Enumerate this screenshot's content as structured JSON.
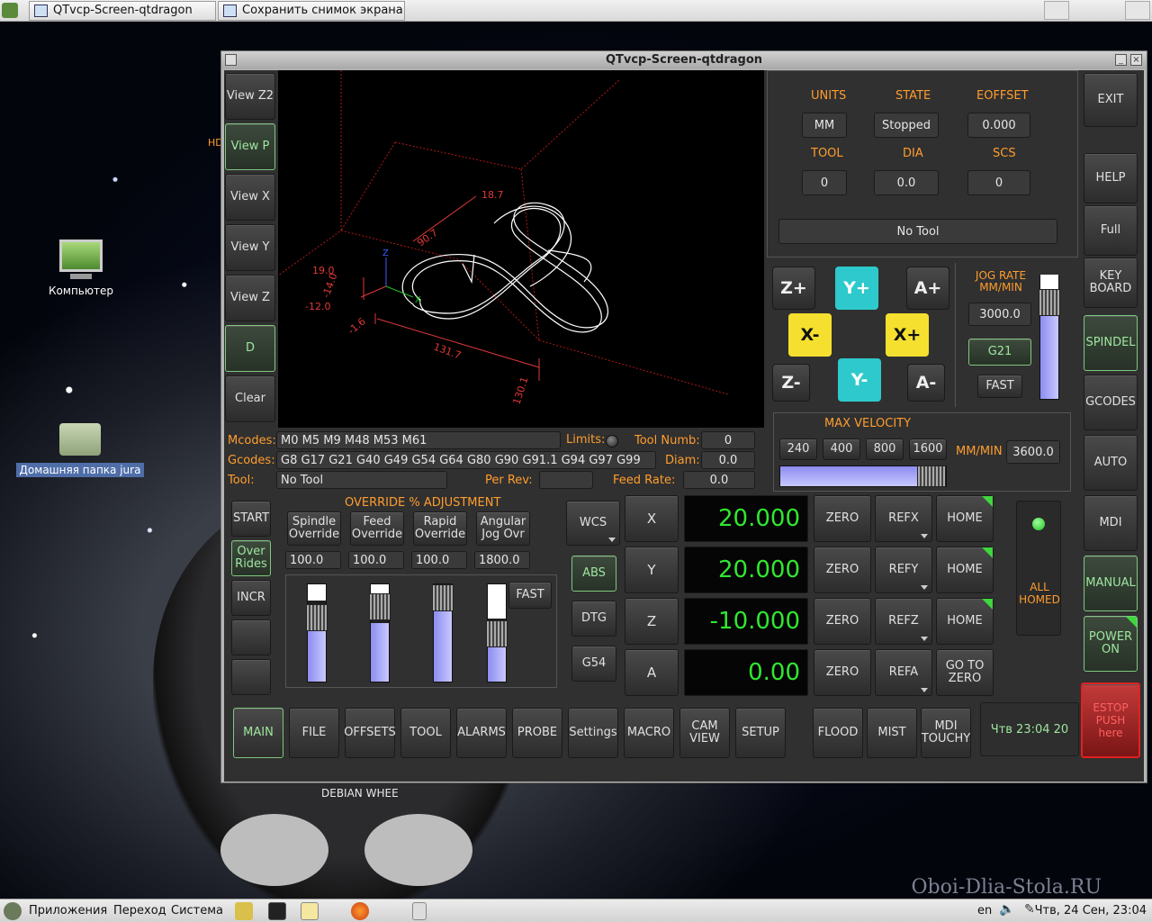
{
  "taskbar": {
    "tasks": [
      "QTvcp-Screen-qtdragon",
      "Сохранить снимок экрана"
    ]
  },
  "desktop": {
    "icons": [
      {
        "label": "Компьютер",
        "icon": "computer-icon"
      },
      {
        "label": "Домашняя папка jura",
        "icon": "home-folder-icon"
      }
    ],
    "watermark": "Oboi-Dlia-Stola.RU",
    "partial_label": "HD",
    "under_window_text": "DEBIAN WHEE"
  },
  "window": {
    "title": "QTvcp-Screen-qtdragon"
  },
  "view_buttons": [
    "View Z2",
    "View P",
    "View X",
    "View Y",
    "View Z",
    "D",
    "Clear"
  ],
  "viewport_labels": {
    "dims": [
      "19.0",
      "-14.0",
      "-12.0",
      "-1.6",
      "131.7",
      "130.1",
      "90.7",
      "18.7"
    ],
    "axis_z": "Z",
    "axis_x": "X"
  },
  "status": {
    "units_label": "UNITS",
    "units_value": "MM",
    "state_label": "STATE",
    "state_value": "Stopped",
    "eoffset_label": "EOFFSET",
    "eoffset_value": "0.000",
    "tool_label": "TOOL",
    "tool_value": "0",
    "dia_label": "DIA",
    "dia_value": "0.0",
    "scs_label": "SCS",
    "scs_value": "0",
    "tool_desc": "No Tool"
  },
  "right_buttons": [
    "EXIT",
    "HELP",
    "Full",
    "KEY BOARD",
    "SPINDEL",
    "GCODES",
    "AUTO",
    "MDI",
    "MANUAL",
    "POWER ON",
    "ESTOP PUSH here"
  ],
  "jog": {
    "z_plus": "Z+",
    "y_plus": "Y+",
    "a_plus": "A+",
    "x_minus": "X-",
    "x_plus": "X+",
    "z_minus": "Z-",
    "y_minus": "Y-",
    "a_minus": "A-",
    "rate_label": "JOG RATE MM/MIN",
    "rate_value": "3000.0",
    "units_button": "G21",
    "fast_button": "FAST",
    "rate_slider_level": 0.8
  },
  "max_velocity": {
    "label": "MAX VELOCITY",
    "presets": [
      "240",
      "400",
      "800",
      "1600"
    ],
    "units": "MM/MIN",
    "value": "3600.0",
    "slider_level": 0.95
  },
  "codes": {
    "mcodes_label": "Mcodes:",
    "mcodes_value": "M0 M5 M9 M48 M53 M61",
    "limits_label": "Limits:",
    "toolnum_label": "Tool Numb:",
    "toolnum_value": "0",
    "gcodes_label": "Gcodes:",
    "gcodes_value": "G8 G17 G21 G40 G49 G54 G64 G80 G90 G91.1 G94 G97 G99",
    "diam_label": "Diam:",
    "diam_value": "0.0",
    "tool_label": "Tool:",
    "tool_value": "No Tool",
    "perrev_label": "Per Rev:",
    "perrev_value": "",
    "feedrate_label": "Feed Rate:",
    "feedrate_value": "0.0"
  },
  "left_mode_buttons": [
    "START",
    "Over Rides",
    "INCR",
    "",
    ""
  ],
  "overrides": {
    "title": "OVERRIDE  %  ADJUSTMENT",
    "items": [
      {
        "label": "Spindle Override",
        "value": "100.0",
        "level": 0.55
      },
      {
        "label": "Feed Override",
        "value": "100.0",
        "level": 0.6
      },
      {
        "label": "Rapid Override",
        "value": "100.0",
        "level": 0.75
      },
      {
        "label": "Angular Jog Ovr",
        "value": "1800.0",
        "level": 0.38
      }
    ],
    "fast_button": "FAST"
  },
  "coord_buttons": [
    "WCS",
    "ABS",
    "DTG",
    "G54"
  ],
  "dro": {
    "axes": [
      {
        "axis": "X",
        "value": "20.000",
        "ref": "REFX",
        "home": "HOME"
      },
      {
        "axis": "Y",
        "value": "20.000",
        "ref": "REFY",
        "home": "HOME"
      },
      {
        "axis": "Z",
        "value": "-10.000",
        "ref": "REFZ",
        "home": "HOME"
      },
      {
        "axis": "A",
        "value": "0.00",
        "ref": "REFA",
        "home": "GO TO ZERO"
      }
    ],
    "zero_label": "ZERO",
    "all_homed": "ALL HOMED"
  },
  "tabs": [
    "MAIN",
    "FILE",
    "OFFSETS",
    "TOOL",
    "ALARMS",
    "PROBE",
    "Settings",
    "MACRO",
    "CAM VIEW",
    "SETUP"
  ],
  "coolant": [
    "FLOOD",
    "MIST",
    "MDI TOUCHY"
  ],
  "datetime": "Чтв 23:04 20",
  "panel": {
    "menus": [
      "Приложения",
      "Переход",
      "Система"
    ],
    "lang": "en",
    "clock": "Чтв, 24 Сен, 23:04"
  },
  "colors": {
    "accent_green": "#3fd63f",
    "jog_cyan": "#2ec9cc",
    "jog_yellow": "#f5e02f",
    "label_orange": "#ff9d2e",
    "estop_red": "#e02020"
  }
}
